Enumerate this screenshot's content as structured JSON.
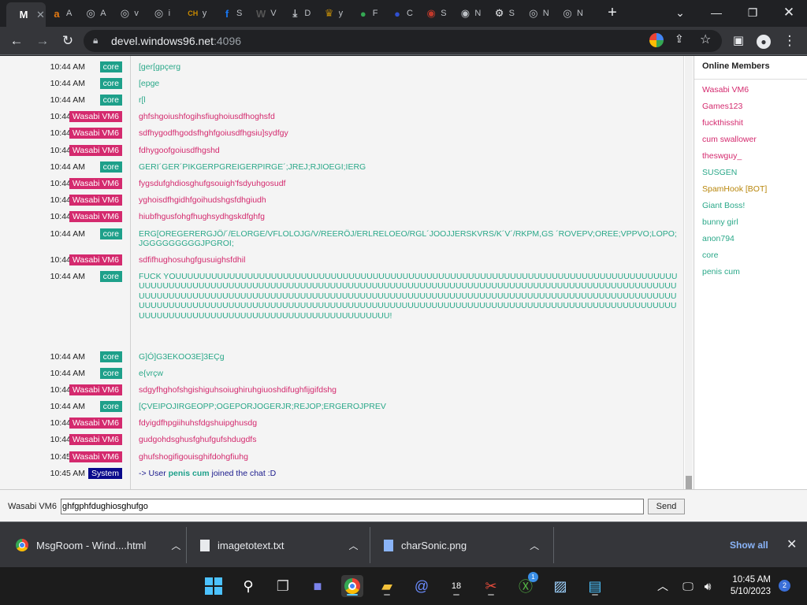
{
  "browser": {
    "tabs": [
      {
        "title": "M",
        "icon": "msgroom-icon",
        "glyph": "M",
        "color": "#ffffff",
        "active": true
      },
      {
        "title": "A",
        "icon": "amazon-icon",
        "glyph": "a",
        "color": "#e47911"
      },
      {
        "title": "A",
        "icon": "globe-icon",
        "glyph": "◎",
        "color": "#bdc1c6"
      },
      {
        "title": "v",
        "icon": "globe-icon",
        "glyph": "◎",
        "color": "#bdc1c6"
      },
      {
        "title": "i",
        "icon": "globe-icon",
        "glyph": "◎",
        "color": "#bdc1c6"
      },
      {
        "title": "y",
        "icon": "ch-icon",
        "glyph": "CH",
        "color": "#c98a00"
      },
      {
        "title": "S",
        "icon": "facebook-icon",
        "glyph": "f",
        "color": "#1877f2"
      },
      {
        "title": "V",
        "icon": "wtf-icon",
        "glyph": "W",
        "color": "#555555"
      },
      {
        "title": "D",
        "icon": "download-icon",
        "glyph": "⤓",
        "color": "#bdc1c6"
      },
      {
        "title": "y",
        "icon": "shield-icon",
        "glyph": "♛",
        "color": "#b8860b"
      },
      {
        "title": "F",
        "icon": "chrome-icon",
        "glyph": "●",
        "color": "#34a853"
      },
      {
        "title": "C",
        "icon": "orb-icon",
        "glyph": "●",
        "color": "#3050d0"
      },
      {
        "title": "S",
        "icon": "target-icon",
        "glyph": "◉",
        "color": "#c0392b"
      },
      {
        "title": "N",
        "icon": "chrome-icon",
        "glyph": "◉",
        "color": "#bdc1c6"
      },
      {
        "title": "S",
        "icon": "settings-icon",
        "glyph": "⚙",
        "color": "#e8eaed"
      },
      {
        "title": "N",
        "icon": "globe-icon",
        "glyph": "◎",
        "color": "#bdc1c6"
      },
      {
        "title": "N",
        "icon": "globe-icon",
        "glyph": "◎",
        "color": "#bdc1c6"
      }
    ],
    "url_host": "devel.windows96.net",
    "url_port": ":4096"
  },
  "chat": {
    "messages": [
      {
        "time": "10:44 AM",
        "user": "core",
        "text": "[ger[gpçerg",
        "color": "#2aa889"
      },
      {
        "time": "10:44 AM",
        "user": "core",
        "text": "[epge",
        "color": "#2aa889"
      },
      {
        "time": "10:44 AM",
        "user": "core",
        "text": "r[l",
        "color": "#2aa889"
      },
      {
        "time": "10:44 AM",
        "user": "Wasabi VM6",
        "text": "ghfshgoiushfogihsfiughoiusdfhoghsfd",
        "color": "#d42a6e"
      },
      {
        "time": "10:44 AM",
        "user": "Wasabi VM6",
        "text": "sdfhygodfhgodsfhghfgoiusdfhgsiu]sydfgy",
        "color": "#d42a6e"
      },
      {
        "time": "10:44 AM",
        "user": "Wasabi VM6",
        "text": "fdhygoofgoiusdfhgshd",
        "color": "#d42a6e"
      },
      {
        "time": "10:44 AM",
        "user": "core",
        "text": "GERI´GER´PIKGERPGREIGERPIRGE´;JREJ;RJIOEGI;IERG",
        "color": "#2aa889"
      },
      {
        "time": "10:44 AM",
        "user": "Wasabi VM6",
        "text": "fygsdufghdiosghufgsouigh'fsdyuhgosudf",
        "color": "#d42a6e"
      },
      {
        "time": "10:44 AM",
        "user": "Wasabi VM6",
        "text": "yghoisdfhgidhfgoihudshgsfdhgiudh",
        "color": "#d42a6e"
      },
      {
        "time": "10:44 AM",
        "user": "Wasabi VM6",
        "text": "hiubfhgusfohgfhughsydhgskdfghfg",
        "color": "#d42a6e"
      },
      {
        "time": "10:44 AM",
        "user": "core",
        "text": "ERG[OREGERERGJÖ/´/ELORGE/VFLOLOJG/V/REERÖJ/ERLRELOEO/RGL´JOOJJERSKVRS/K´V´/RKPM,GS ´ROVEPV;OREE;VPPVO;LOPO;JGGGGGGGGGJPGROI;",
        "color": "#2aa889"
      },
      {
        "time": "10:44 AM",
        "user": "Wasabi VM6",
        "text": "sdfifhughosuhgfgusuighsfdhil",
        "color": "#d42a6e"
      },
      {
        "time": "10:44 AM",
        "user": "core",
        "text": "FUCK YOUUUUUUUUUUUUUUUUUUUUUUUUUUUUUUUUUUUUUUUUUUUUUUUUUUUUUUUUUUUUUUUUUUUUUUUUUUUUUUUUUUUUUUUUUUUUUUUUUUUUUUUUUUUUUUUUUUUUUUUUUUUUUUUUUUUUUUUUUUUUUUUUUUUUUUUUUUUUUUUUUUUUUUUUUUUUUUUUUUUUUUUUUUUUUUUUUUUUUUUUUUUUUUUUUUUUUUUUUUUUUUUUUUUUUUUUUUUUUUUUUUUUUUUUUUUUUUUUUUUUUUUUUUUUUUUUUUUUUUUUUUUUUUUUUUUUUUUUUUUUUUUUUUUUUUUUUUUUUUUUUUUUUUUUUUUUUUUUUUUUUUUUUUUUUUUUUUUUUUUUUUUUUUUUUUUUUUUUUUUUUUUUUUUUUUUUUUUU!",
        "color": "#2aa889"
      },
      {
        "time": "10:44 AM",
        "user": "core",
        "text": "G]Ó]G3EKOO3E]3EÇg",
        "color": "#2aa889"
      },
      {
        "time": "10:44 AM",
        "user": "core",
        "text": "e{vrçw",
        "color": "#2aa889"
      },
      {
        "time": "10:44 AM",
        "user": "Wasabi VM6",
        "text": "sdgyfhghofshgishiguhsoiughiruhgiuoshdifughfijgifdshg",
        "color": "#d42a6e"
      },
      {
        "time": "10:44 AM",
        "user": "core",
        "text": "[ÇVEIPOJIRGEOPP;OGEPORJOGERJR;REJOP;ERGEROJPREV",
        "color": "#2aa889"
      },
      {
        "time": "10:44 AM",
        "user": "Wasabi VM6",
        "text": "fdyigdfhpgiihuhsfdgshuipghusdg",
        "color": "#d42a6e"
      },
      {
        "time": "10:44 AM",
        "user": "Wasabi VM6",
        "text": "gudgohdsghusfghufgufshdugdfs",
        "color": "#d42a6e"
      },
      {
        "time": "10:45 AM",
        "user": "Wasabi VM6",
        "text": "ghufshogifigouisghifdohgfiuhg",
        "color": "#d42a6e"
      },
      {
        "time": "10:45 AM",
        "user": "System",
        "text_prefix": "-> User ",
        "text_user": "penis cum",
        "text_suffix": " joined the chat :D",
        "color": "#1a1a8c"
      }
    ]
  },
  "members": {
    "title": "Online Members",
    "list": [
      {
        "name": "Wasabi VM6",
        "color": "#d42a6e"
      },
      {
        "name": "Games123",
        "color": "#d42a6e"
      },
      {
        "name": "fuckthisshit",
        "color": "#d42a6e"
      },
      {
        "name": "cum swallower",
        "color": "#d42a6e"
      },
      {
        "name": "theswguy_",
        "color": "#d42a6e"
      },
      {
        "name": "SUSGEN",
        "color": "#2aa889"
      },
      {
        "name": "SpamHook [BOT]",
        "color": "#b8860b"
      },
      {
        "name": "Giant Boss!",
        "color": "#2aa889"
      },
      {
        "name": "bunny girl",
        "color": "#2aa889"
      },
      {
        "name": "anon794",
        "color": "#2aa889"
      },
      {
        "name": "core",
        "color": "#2aa889"
      },
      {
        "name": "penis cum",
        "color": "#2aa889"
      }
    ]
  },
  "composer": {
    "username": "Wasabi VM6",
    "value": "ghfgphfdughiosghufgo",
    "send_label": "Send"
  },
  "downloads": {
    "items": [
      {
        "name": "MsgRoom - Wind....html",
        "icon": "chrome-icon"
      },
      {
        "name": "imagetotext.txt",
        "icon": "document-icon"
      },
      {
        "name": "charSonic.png",
        "icon": "image-file-icon"
      }
    ],
    "show_all": "Show all"
  },
  "taskbar": {
    "time": "10:45 AM",
    "date": "5/10/2023",
    "notifications": "2",
    "mail_badge": "1",
    "calendar_day": "18"
  }
}
